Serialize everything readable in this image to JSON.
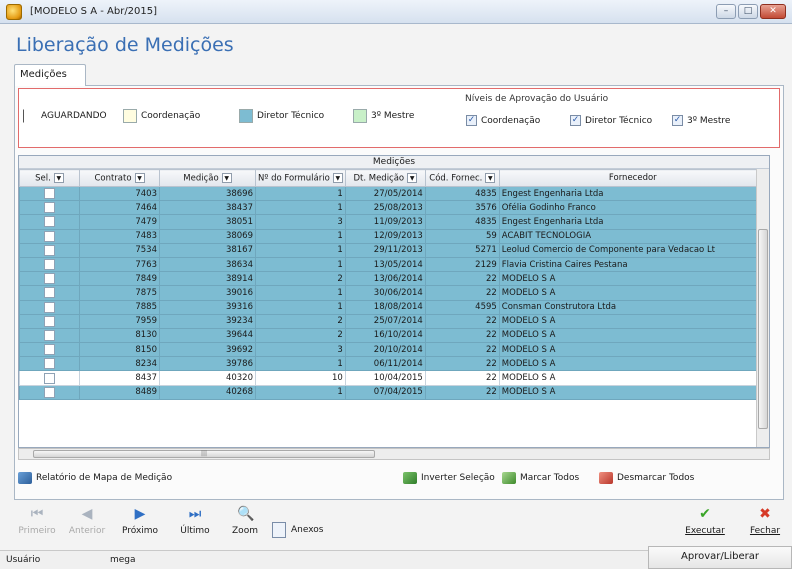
{
  "window": {
    "title": "[MODELO S A - Abr/2015]"
  },
  "page": {
    "title": "Liberação de Medições"
  },
  "tab": {
    "label": "Medições"
  },
  "legend": {
    "aguardando": "AGUARDANDO",
    "coordenacao": "Coordenação",
    "diretor": "Diretor Técnico",
    "mestre": "3º Mestre",
    "colors": {
      "aguardando": "#ffffff",
      "coordenacao": "#fffde0",
      "diretor": "#7dbcd2",
      "mestre": "#c8f0c8"
    }
  },
  "levels": {
    "title": "Níveis de Aprovação do Usuário",
    "coordenacao": "Coordenação",
    "diretor": "Diretor Técnico",
    "mestre": "3º Mestre"
  },
  "grid": {
    "caption": "Medições",
    "columns": [
      "Sel.",
      "Contrato",
      "Medição",
      "Nº do Formulário",
      "Dt. Medição",
      "Cód. Fornec.",
      "Fornecedor"
    ],
    "rows": [
      [
        "7403",
        "38696",
        "1",
        "27/05/2014",
        "4835",
        "Engest Engenharia Ltda"
      ],
      [
        "7464",
        "38437",
        "1",
        "25/08/2013",
        "3576",
        "Ofélia Godinho Franco"
      ],
      [
        "7479",
        "38051",
        "3",
        "11/09/2013",
        "4835",
        "Engest Engenharia Ltda"
      ],
      [
        "7483",
        "38069",
        "1",
        "12/09/2013",
        "59",
        "ACABIT TECNOLOGIA"
      ],
      [
        "7534",
        "38167",
        "1",
        "29/11/2013",
        "5271",
        "Leolud Comercio de Componente para Vedacao Lt"
      ],
      [
        "7763",
        "38634",
        "1",
        "13/05/2014",
        "2129",
        "Flavia Cristina Caires Pestana"
      ],
      [
        "7849",
        "38914",
        "2",
        "13/06/2014",
        "22",
        "MODELO S A"
      ],
      [
        "7875",
        "39016",
        "1",
        "30/06/2014",
        "22",
        "MODELO S A"
      ],
      [
        "7885",
        "39316",
        "1",
        "18/08/2014",
        "4595",
        "Consman Construtora Ltda"
      ],
      [
        "7959",
        "39234",
        "2",
        "25/07/2014",
        "22",
        "MODELO S A"
      ],
      [
        "8130",
        "39644",
        "2",
        "16/10/2014",
        "22",
        "MODELO S A"
      ],
      [
        "8150",
        "39692",
        "3",
        "20/10/2014",
        "22",
        "MODELO S A"
      ],
      [
        "8234",
        "39786",
        "1",
        "06/11/2014",
        "22",
        "MODELO S A"
      ],
      [
        "8437",
        "40320",
        "10",
        "10/04/2015",
        "22",
        "MODELO S A"
      ],
      [
        "8489",
        "40268",
        "1",
        "07/04/2015",
        "22",
        "MODELO S A"
      ]
    ],
    "row_status": [
      "blue",
      "blue",
      "blue",
      "blue",
      "blue",
      "blue",
      "blue",
      "blue",
      "blue",
      "blue",
      "blue",
      "blue",
      "blue",
      "white",
      "blue"
    ]
  },
  "actions": {
    "relatorio": "Relatório de Mapa de Medição",
    "inverter": "Inverter Seleção",
    "marcar": "Marcar Todos",
    "desmarcar": "Desmarcar Todos"
  },
  "toolbar": {
    "primeiro": "Primeiro",
    "anterior": "Anterior",
    "proximo": "Próximo",
    "ultimo": "Último",
    "zoom": "Zoom",
    "anexos": "Anexos",
    "executar": "Executar",
    "fechar": "Fechar"
  },
  "status": {
    "label": "Usuário",
    "value": "mega",
    "approve_button": "Aprovar/Liberar"
  }
}
